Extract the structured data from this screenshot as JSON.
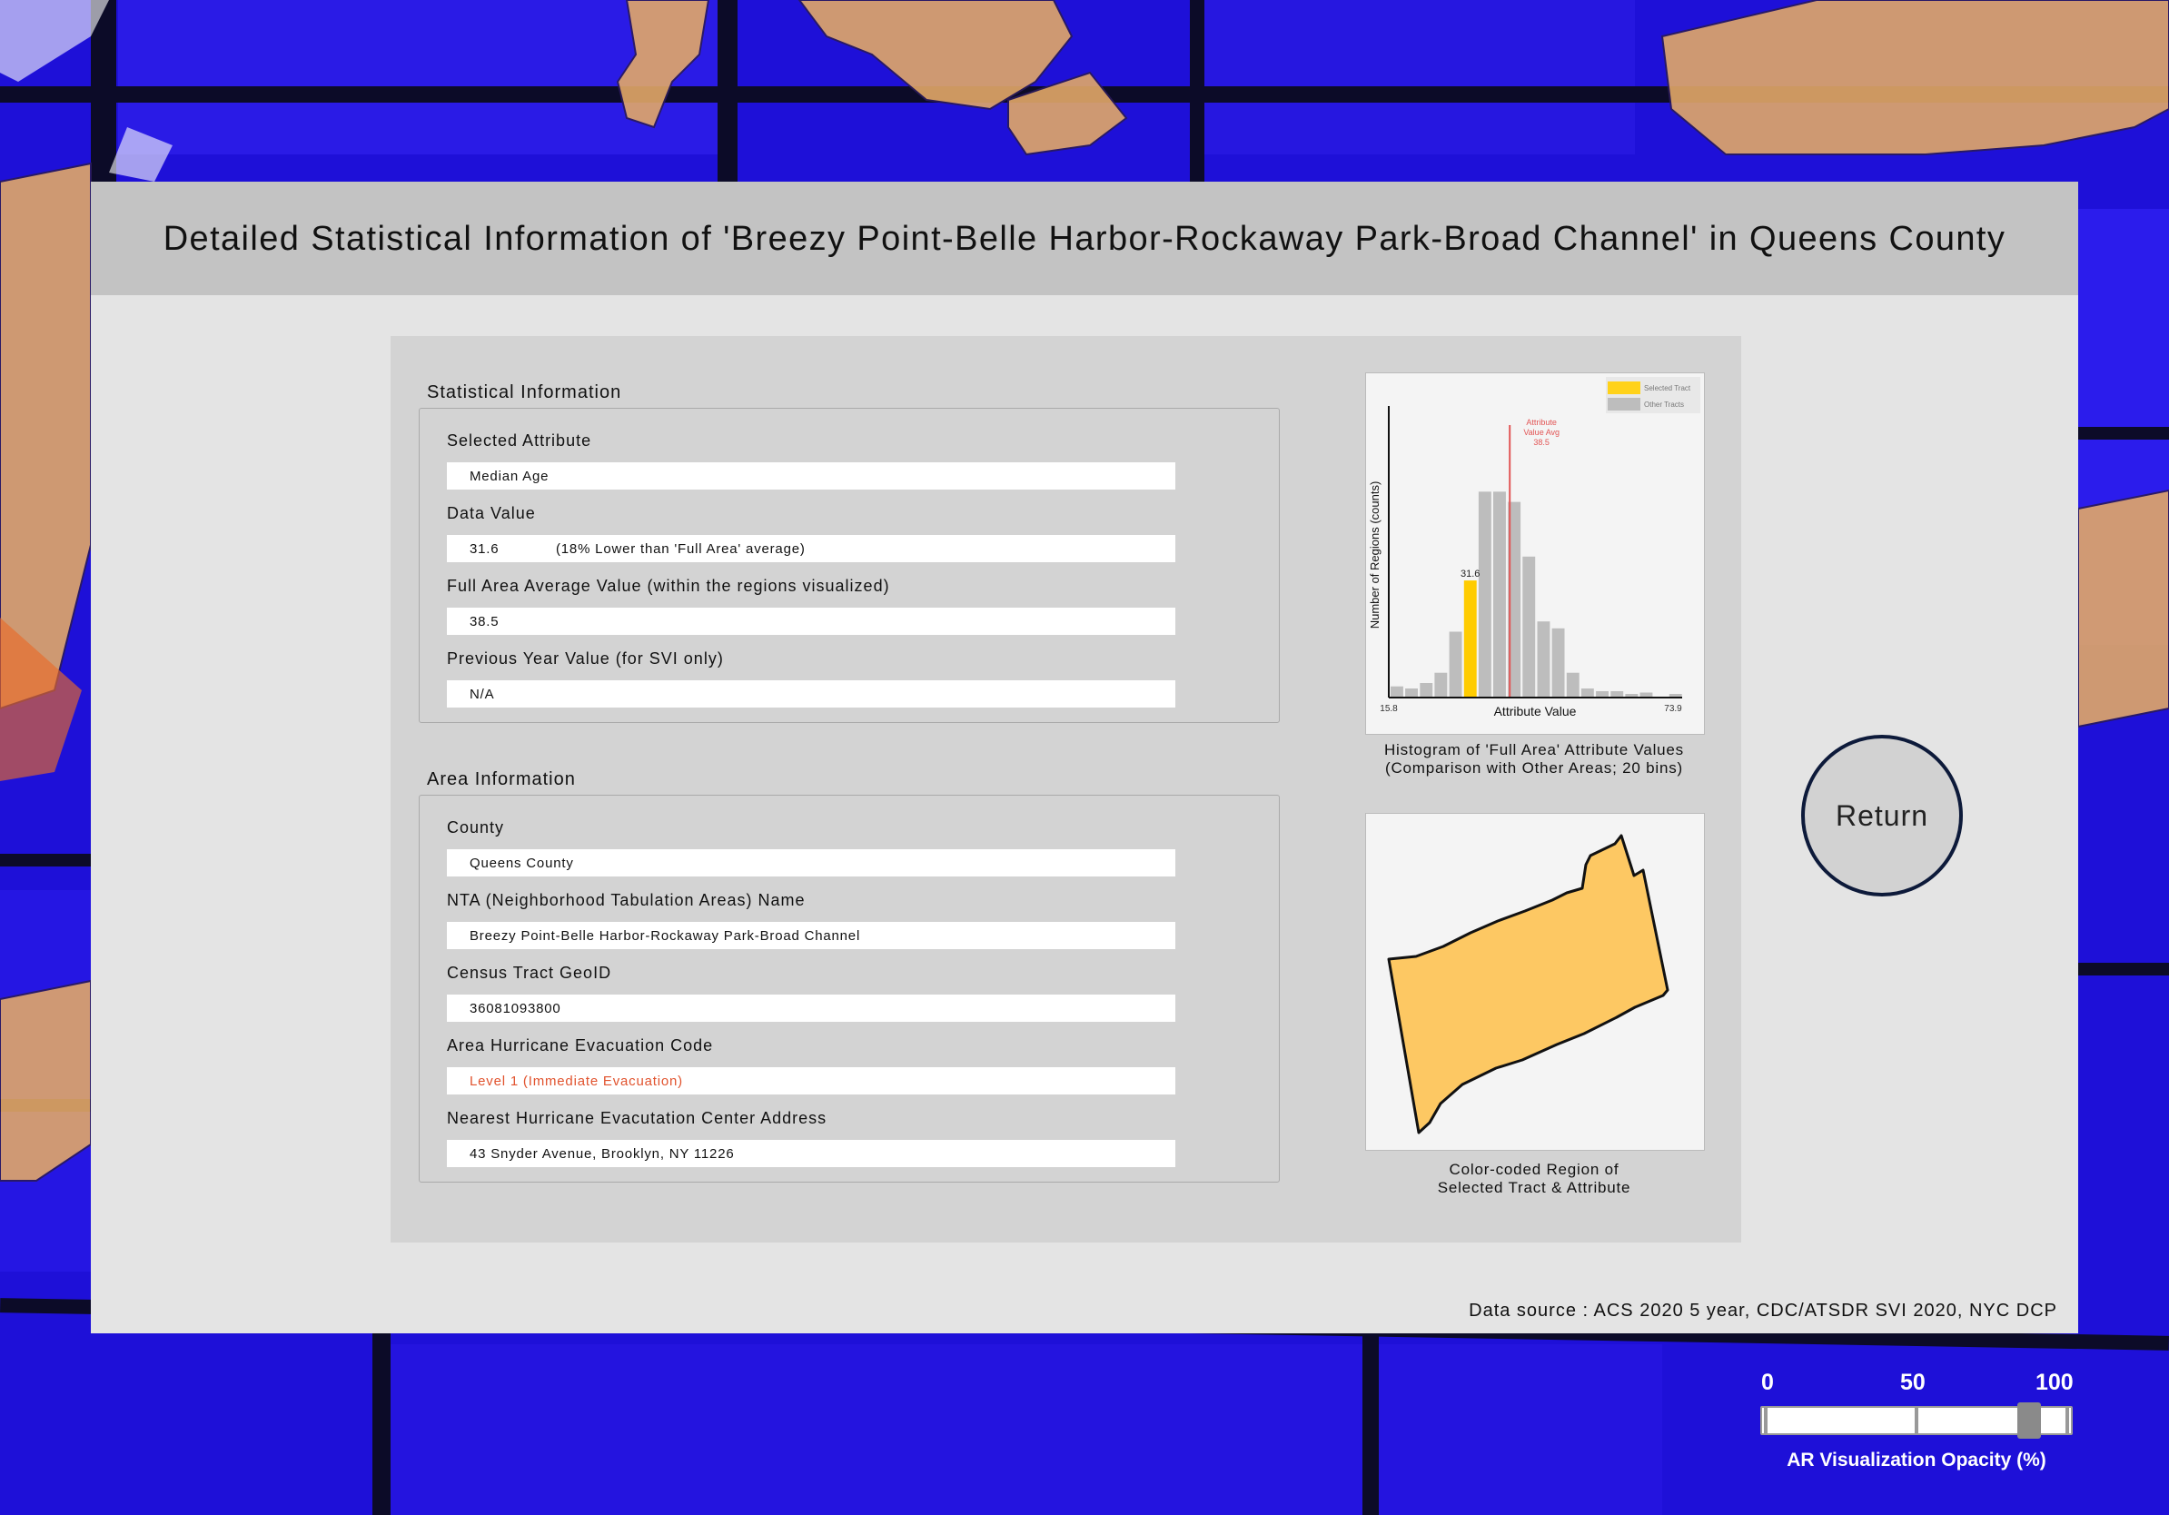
{
  "page": {
    "title": "Detailed Statistical Information of 'Breezy Point-Belle Harbor-Rockaway Park-Broad Channel' in Queens County",
    "data_source": "Data source : ACS 2020 5 year, CDC/ATSDR SVI 2020, NYC DCP"
  },
  "statistical": {
    "heading": "Statistical Information",
    "fields": [
      {
        "label": "Selected Attribute",
        "value": "Median Age"
      },
      {
        "label": "Data Value",
        "value": "31.6",
        "note": "(18% Lower than 'Full Area' average)"
      },
      {
        "label": "Full Area Average Value (within the regions visualized)",
        "value": "38.5"
      },
      {
        "label": "Previous Year Value (for SVI only)",
        "value": "N/A"
      }
    ]
  },
  "area": {
    "heading": "Area Information",
    "fields": [
      {
        "label": "County",
        "value": "Queens County"
      },
      {
        "label": "NTA (Neighborhood Tabulation Areas) Name",
        "value": "Breezy Point-Belle Harbor-Rockaway Park-Broad Channel"
      },
      {
        "label": "Census Tract GeoID",
        "value": "36081093800"
      },
      {
        "label": "Area Hurricane Evacuation Code",
        "value": "Level 1 (Immediate Evacuation)"
      },
      {
        "label": "Nearest Hurricane Evacutation Center Address",
        "value": "43 Snyder Avenue, Brooklyn, NY 11226"
      }
    ]
  },
  "chart_data": {
    "type": "bar",
    "caption": "Histogram of 'Full Area' Attribute Values\n(Comparison with Other Areas; 20 bins)",
    "xlabel": "Attribute Value",
    "ylabel": "Number of Regions (counts)",
    "xlim": [
      15.8,
      73.9
    ],
    "x_tick_labels": [
      "15.8",
      "73.9"
    ],
    "bins": 20,
    "values": [
      1.5,
      1.2,
      2.0,
      3.5,
      9.5,
      17,
      30,
      30,
      28.5,
      20.5,
      11,
      10,
      3.5,
      1.2,
      0.8,
      0.8,
      0.4,
      0.6,
      0,
      0.4
    ],
    "selected_bin": 5,
    "selected_label": "31.6",
    "average": 38.5,
    "average_label": [
      "Attribute",
      "Value Avg",
      "38.5"
    ],
    "legend": [
      {
        "name": "Selected Tract",
        "color": "#ffd21a"
      },
      {
        "name": "Other Tracts",
        "color": "#bdbdbd"
      }
    ],
    "legend_position": "top-right",
    "bar_color": "#bdbdbd",
    "selected_color": "#ffcc00",
    "average_color": "#e25555"
  },
  "map": {
    "caption": "Color-coded Region of\nSelected Tract & Attribute",
    "fill": "#fdc863"
  },
  "return_label": "Return",
  "opacity": {
    "label": "AR Visualization Opacity (%)",
    "ticks": [
      "0",
      "50",
      "100"
    ],
    "value_percent": 87
  }
}
